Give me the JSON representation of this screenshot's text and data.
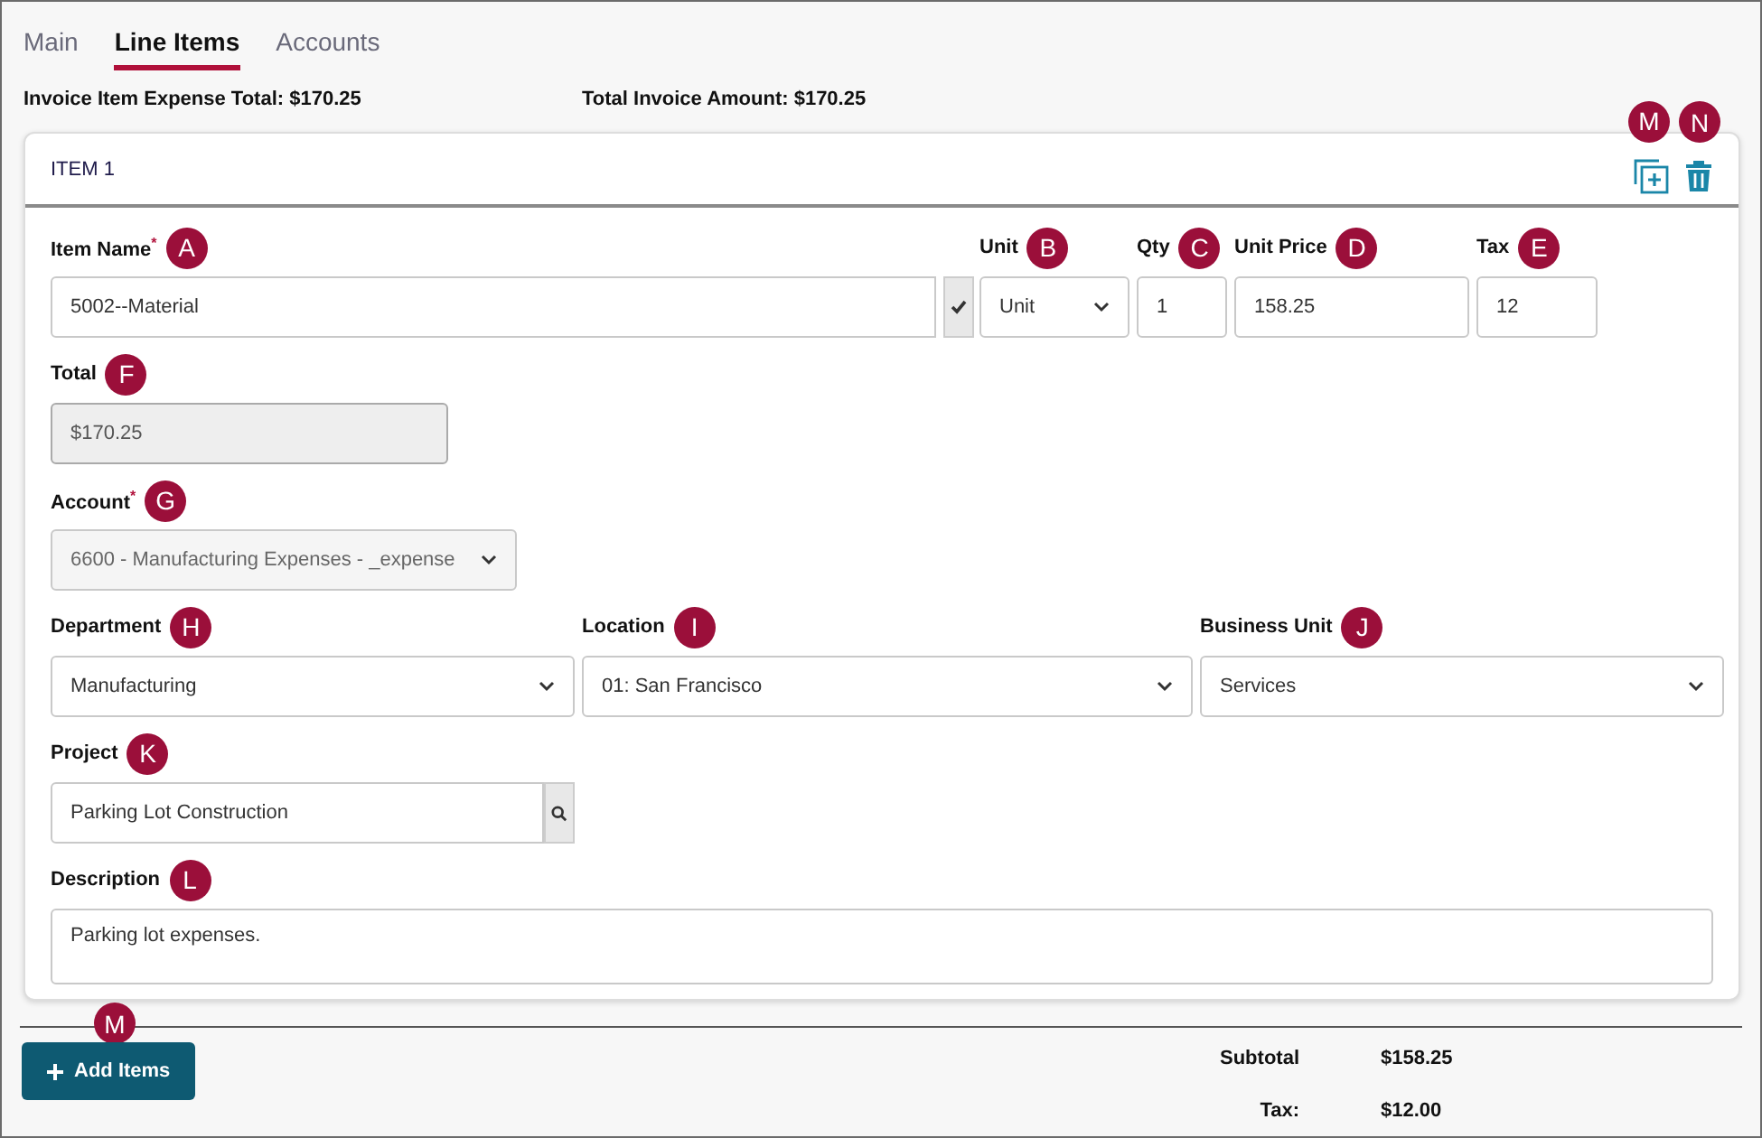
{
  "tabs": [
    {
      "label": "Main",
      "selected": false
    },
    {
      "label": "Line Items",
      "selected": true
    },
    {
      "label": "Accounts",
      "selected": false
    }
  ],
  "summary": [
    "Invoice Item Expense Total: $170.25",
    "Total Invoice Amount: $170.25"
  ],
  "item": {
    "title": "ITEM 1",
    "actions": [
      {
        "kind": "duplicate",
        "badge": "M"
      },
      {
        "kind": "delete",
        "badge": "N"
      }
    ]
  },
  "rows": [
    [
      {
        "label": "Item Name$^{*}$",
        "badge": "A",
        "kind": "lookup-check",
        "value": "5002--Material"
      },
      {
        "label": "Unit",
        "badge": "B",
        "kind": "select",
        "value": "Unit"
      },
      {
        "label": "Qty",
        "badge": "C",
        "kind": "text",
        "value": "1"
      },
      {
        "label": "Unit Price",
        "badge": "D",
        "kind": "text",
        "value": "158.25"
      },
      {
        "label": "Tax",
        "badge": "E",
        "kind": "text",
        "value": "12"
      }
    ],
    [
      {
        "label": "Total",
        "badge": "F",
        "kind": "readonly",
        "value": "$170.25"
      }
    ],
    [
      {
        "label": "Account$^{*}$",
        "badge": "G",
        "kind": "disabled-select",
        "value": "6600 - Manufacturing Expenses - _expense"
      }
    ],
    [
      {
        "label": "Department",
        "badge": "H",
        "kind": "select",
        "value": "Manufacturing"
      },
      {
        "label": "Location",
        "badge": "I",
        "kind": "select",
        "value": "01: San Francisco"
      },
      {
        "label": "Business Unit",
        "badge": "J",
        "kind": "select",
        "value": "Services"
      }
    ],
    [
      {
        "label": "Project",
        "badge": "K",
        "kind": "lookup-search",
        "value": "Parking Lot Construction"
      }
    ],
    [
      {
        "label": "Description",
        "badge": "L",
        "kind": "textarea",
        "value": "Parking lot expenses."
      }
    ]
  ],
  "add_button": {
    "label": "Add Items",
    "badge": "M"
  },
  "totals": [
    {
      "label": "Subtotal",
      "value": "$158.25"
    },
    {
      "label": "Tax:",
      "value": "$12.00"
    }
  ]
}
